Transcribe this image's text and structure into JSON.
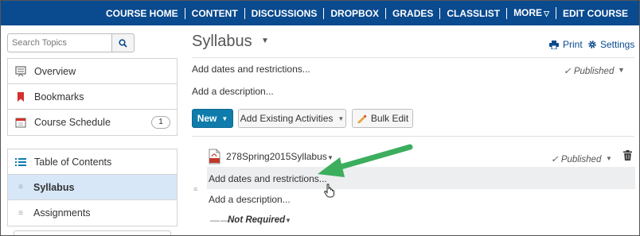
{
  "nav": {
    "items": [
      "COURSE HOME",
      "CONTENT",
      "DISCUSSIONS",
      "DROPBOX",
      "GRADES",
      "CLASSLIST",
      "MORE",
      "EDIT COURSE"
    ],
    "more_caret": "▽"
  },
  "sidebar": {
    "search_placeholder": "Search Topics",
    "top_items": [
      {
        "label": "Overview",
        "icon": "overview-icon"
      },
      {
        "label": "Bookmarks",
        "icon": "bookmark-icon"
      },
      {
        "label": "Course Schedule",
        "icon": "calendar-icon",
        "badge": "1"
      }
    ],
    "toc": [
      {
        "label": "Table of Contents",
        "icon": "list-icon"
      },
      {
        "label": "Syllabus",
        "active": true
      },
      {
        "label": "Assignments"
      }
    ]
  },
  "main": {
    "title": "Syllabus",
    "print": "Print",
    "settings": "Settings",
    "add_dates": "Add dates and restrictions...",
    "add_description": "Add a description...",
    "published": "Published",
    "buttons": {
      "new": "New",
      "add_existing": "Add Existing Activities",
      "bulk_edit": "Bulk Edit"
    },
    "topic": {
      "name": "278Spring2015Syllabus",
      "published": "Published",
      "add_dates": "Add dates and restrictions...",
      "add_description": "Add a description...",
      "completion_dashes": "——",
      "completion": "Not Required"
    }
  },
  "colors": {
    "nav_bg": "#0a4a8e",
    "accent": "#0f7cab",
    "active_row": "#d7e7f8",
    "arrow": "#3cae5e",
    "pdf_red": "#c0392b"
  }
}
